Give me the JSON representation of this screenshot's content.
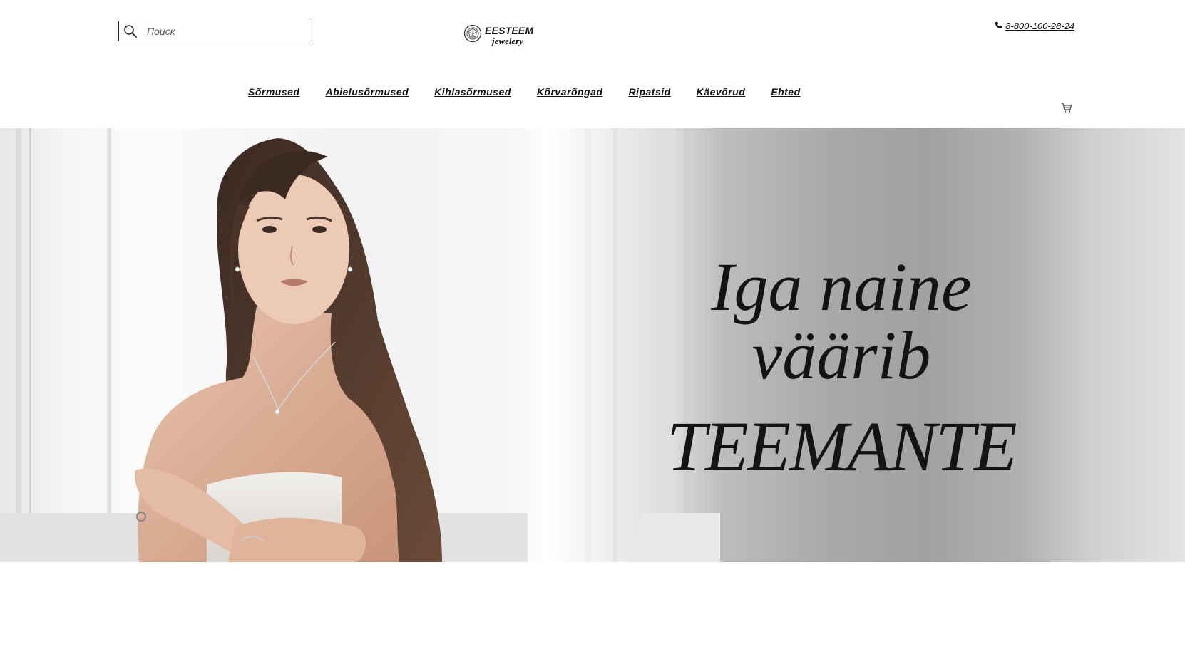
{
  "header": {
    "search": {
      "placeholder": "Поиск",
      "value": ""
    },
    "logo": {
      "name": "EESTEEM",
      "sub": "jewelery"
    },
    "phone": "8-800-100-28-24"
  },
  "nav": {
    "items": [
      {
        "label": "Sõrmused"
      },
      {
        "label": "Abielusõrmused"
      },
      {
        "label": "Kihlasõrmused"
      },
      {
        "label": "Kõrvarõngad"
      },
      {
        "label": "Ripatsid"
      },
      {
        "label": "Käevõrud"
      },
      {
        "label": "Ehted"
      }
    ]
  },
  "hero": {
    "line1": "Iga naine väärib",
    "line2": "TEEMANTE"
  },
  "icons": {
    "search": "search-icon",
    "logo": "diamond-logo-icon",
    "phone": "phone-icon",
    "cart": "cart-icon"
  }
}
